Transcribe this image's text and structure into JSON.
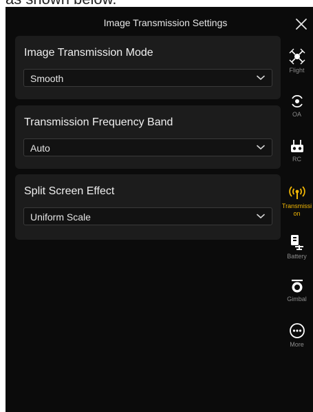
{
  "top_fragment": "as shown below.",
  "header": {
    "title": "Image Transmission Settings"
  },
  "cards": [
    {
      "title": "Image Transmission Mode",
      "value": "Smooth"
    },
    {
      "title": "Transmission Frequency Band",
      "value": "Auto"
    },
    {
      "title": "Split Screen Effect",
      "value": "Uniform Scale"
    }
  ],
  "sidebar": {
    "active_color": "#f2b705",
    "items": [
      {
        "label": "Flight",
        "icon": "drone-icon"
      },
      {
        "label": "OA",
        "icon": "obstacle-avoidance-icon"
      },
      {
        "label": "RC",
        "icon": "remote-controller-icon"
      },
      {
        "label": "Transmission",
        "icon": "transmission-icon",
        "active": true
      },
      {
        "label": "Battery",
        "icon": "battery-icon"
      },
      {
        "label": "Gimbal",
        "icon": "gimbal-icon"
      },
      {
        "label": "More",
        "icon": "more-icon"
      }
    ]
  }
}
